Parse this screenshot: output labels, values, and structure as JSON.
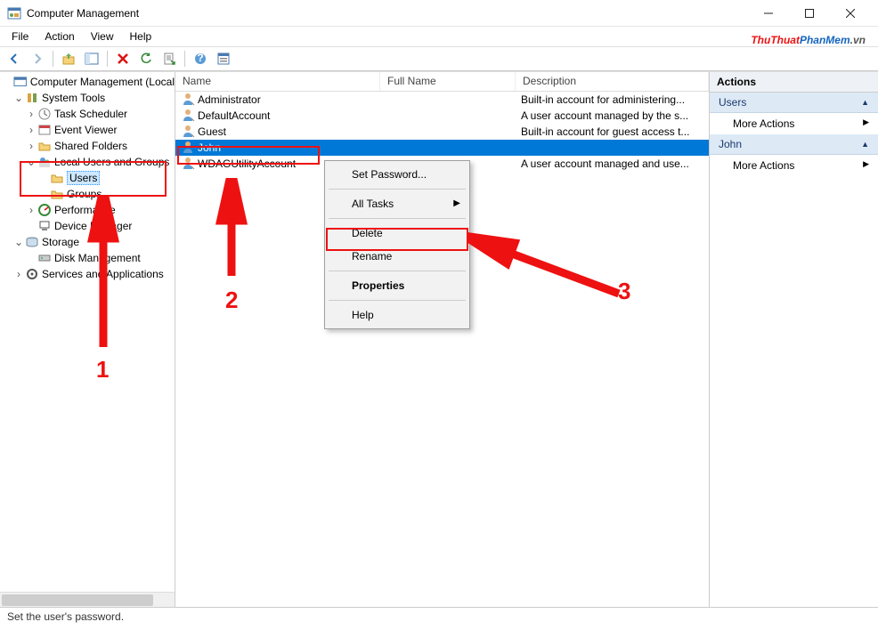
{
  "window": {
    "title": "Computer Management"
  },
  "watermark": {
    "part1": "ThuThuat",
    "part2": "PhanMem",
    "part3": ".vn"
  },
  "menubar": [
    "File",
    "Action",
    "View",
    "Help"
  ],
  "tree": {
    "root": "Computer Management (Local",
    "system_tools": "System Tools",
    "task_scheduler": "Task Scheduler",
    "event_viewer": "Event Viewer",
    "shared_folders": "Shared Folders",
    "local_users_groups": "Local Users and Groups",
    "users": "Users",
    "groups": "Groups",
    "performance": "Performance",
    "device_manager": "Device Manager",
    "storage": "Storage",
    "disk_management": "Disk Management",
    "services_apps": "Services and Applications"
  },
  "list": {
    "headers": {
      "name": "Name",
      "fullname": "Full Name",
      "description": "Description"
    },
    "rows": [
      {
        "name": "Administrator",
        "full": "",
        "desc": "Built-in account for administering..."
      },
      {
        "name": "DefaultAccount",
        "full": "",
        "desc": "A user account managed by the s..."
      },
      {
        "name": "Guest",
        "full": "",
        "desc": "Built-in account for guest access t..."
      },
      {
        "name": "John",
        "full": "",
        "desc": ""
      },
      {
        "name": "WDAGUtilityAccount",
        "full": "",
        "desc": "A user account managed and use..."
      }
    ]
  },
  "context_menu": {
    "set_password": "Set Password...",
    "all_tasks": "All Tasks",
    "delete": "Delete",
    "rename": "Rename",
    "properties": "Properties",
    "help": "Help"
  },
  "actions": {
    "header": "Actions",
    "sec1": "Users",
    "sec2": "John",
    "more": "More Actions"
  },
  "status": "Set the user's password.",
  "annotations": {
    "n1": "1",
    "n2": "2",
    "n3": "3"
  }
}
